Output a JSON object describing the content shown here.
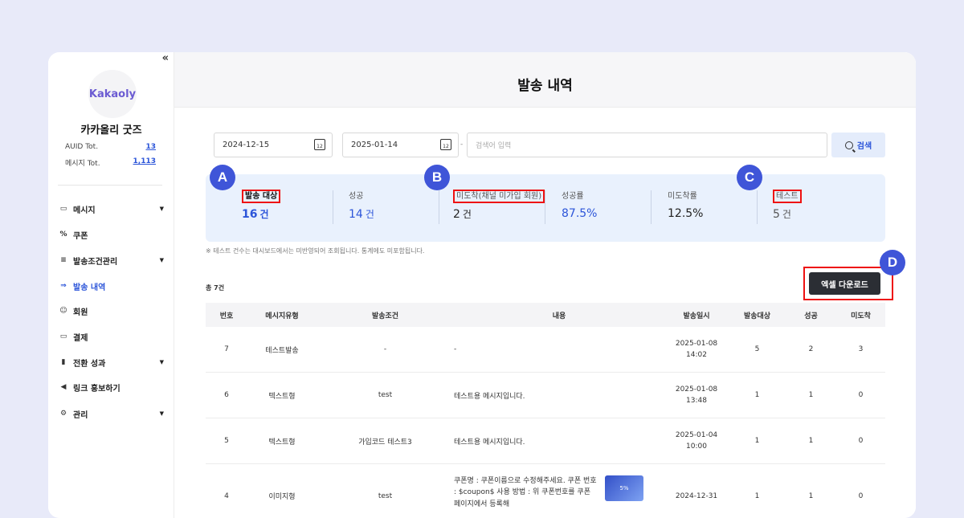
{
  "sidebar": {
    "collapse_icon": "«",
    "logo_text": "Kakaoly",
    "brand": "카카올리 굿즈",
    "stats": [
      {
        "label": "AUID Tot.",
        "value": "13"
      },
      {
        "label": "메시지 Tot.",
        "value": "1,113"
      }
    ],
    "items": [
      {
        "icon": "message-icon",
        "label": "메시지",
        "has_caret": true
      },
      {
        "icon": "percent-icon",
        "label": "쿠폰",
        "has_caret": false
      },
      {
        "icon": "condition-search-icon",
        "label": "발송조건관리",
        "has_caret": true
      },
      {
        "icon": "send-history-icon",
        "label": "발송 내역",
        "has_caret": false,
        "active": true
      },
      {
        "icon": "members-icon",
        "label": "회원",
        "has_caret": false
      },
      {
        "icon": "card-icon",
        "label": "결제",
        "has_caret": false
      },
      {
        "icon": "bar-chart-icon",
        "label": "전환 성과",
        "has_caret": true
      },
      {
        "icon": "megaphone-icon",
        "label": "링크 홍보하기",
        "has_caret": false
      },
      {
        "icon": "gear-icon",
        "label": "관리",
        "has_caret": true
      }
    ]
  },
  "header": {
    "title": "발송 내역"
  },
  "filters": {
    "start_date": "2024-12-15",
    "end_date": "2025-01-14",
    "separator": "-",
    "search_placeholder": "검색어 입력",
    "search_button": "검색"
  },
  "summary": [
    {
      "label": "발송 대상",
      "value": "16",
      "unit": "건",
      "highlight": true
    },
    {
      "label": "성공",
      "value": "14",
      "unit": "건"
    },
    {
      "label": "미도착(채널 미가입 회원)",
      "value": "2",
      "unit": "건",
      "highlight": true
    },
    {
      "label": "성공률",
      "value": "87.5%",
      "unit": ""
    },
    {
      "label": "미도착률",
      "value": "12.5%",
      "unit": ""
    },
    {
      "label": "테스트",
      "value": "5",
      "unit": "건",
      "highlight": true
    }
  ],
  "badges": {
    "a": "A",
    "b": "B",
    "c": "C",
    "d": "D"
  },
  "note": "※ 테스트 건수는 대시보드에서는 미반영되어 조회됩니다. 통계에도 미포함됩니다.",
  "total": "총 7건",
  "excel_button": "엑셀 다운로드",
  "table": {
    "headers": [
      "번호",
      "메시지유형",
      "발송조건",
      "내용",
      "발송일시",
      "발송대상",
      "성공",
      "미도착"
    ],
    "rows": [
      {
        "no": "7",
        "type": "테스트발송",
        "condition": "-",
        "content": "-",
        "date": "2025-01-08",
        "time": "14:02",
        "target": "5",
        "success": "2",
        "fail": "3"
      },
      {
        "no": "6",
        "type": "텍스트형",
        "condition": "test",
        "content": "테스트용 메시지입니다.",
        "date": "2025-01-08",
        "time": "13:48",
        "target": "1",
        "success": "1",
        "fail": "0"
      },
      {
        "no": "5",
        "type": "텍스트형",
        "condition": "가입코드 테스트3",
        "content": "테스트용 메시지입니다.",
        "date": "2025-01-04",
        "time": "10:00",
        "target": "1",
        "success": "1",
        "fail": "0"
      },
      {
        "no": "4",
        "type": "이미지형",
        "condition": "test",
        "content": "쿠폰명 : 쿠폰이름으로 수정해주세요. 쿠폰 번호 : $coupon$ 사용 방법 : 위 쿠폰번호를 쿠폰 페이지에서 등록해",
        "date": "2024-12-31",
        "time": "",
        "target": "1",
        "success": "1",
        "fail": "0"
      }
    ]
  }
}
